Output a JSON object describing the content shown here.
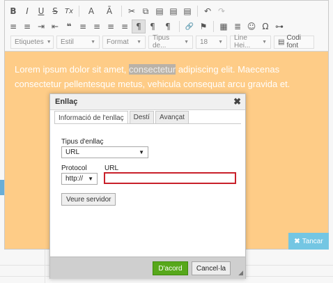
{
  "toolbar": {
    "row1": [
      "B",
      "I",
      "U",
      "S",
      "Tx",
      "A",
      "Ā",
      "✂",
      "⧉",
      "▤",
      "▤",
      "▤",
      "↶",
      "↷"
    ],
    "row2": [
      "≡",
      "≡",
      "⇥",
      "⇤",
      "❝",
      "≡",
      "≡",
      "≡",
      "≡",
      "¶",
      "¶",
      "¶",
      "🔗",
      "⚑",
      "▦",
      "≣",
      "☺",
      "Ω",
      "⊶"
    ],
    "formats": {
      "labels": "Etiquetes",
      "style": "Estil",
      "format": "Format",
      "font": "Tipus de...",
      "size": "18",
      "line_height": "Line Hei...",
      "source": "Codi font"
    }
  },
  "content": {
    "before": "Lorem ipsum dolor sit amet, ",
    "highlight": "consectetur",
    "after": " adipiscing elit. Maecenas consectetur pellentesque metus, vehicula consequat arcu gravida et."
  },
  "editor": {
    "cancel_label": "Tancar",
    "cancel_icon": "x-icon"
  },
  "dialog": {
    "title": "Enllaç",
    "close": "✖",
    "tabs": [
      "Informació de l'enllaç",
      "Destí",
      "Avançat"
    ],
    "link_type_label": "Tipus d'enllaç",
    "link_type_value": "URL",
    "protocol_label": "Protocol",
    "protocol_value": "http://",
    "url_label": "URL",
    "url_value": "",
    "browse_button": "Veure servidor",
    "ok_button": "D'acord",
    "cancel_button": "Cancel·la"
  },
  "colors": {
    "editor_bg": "#fecc87",
    "url_border": "#c8202a",
    "ok_bg": "#57a81b",
    "cancel_bg": "#74c6e3"
  }
}
